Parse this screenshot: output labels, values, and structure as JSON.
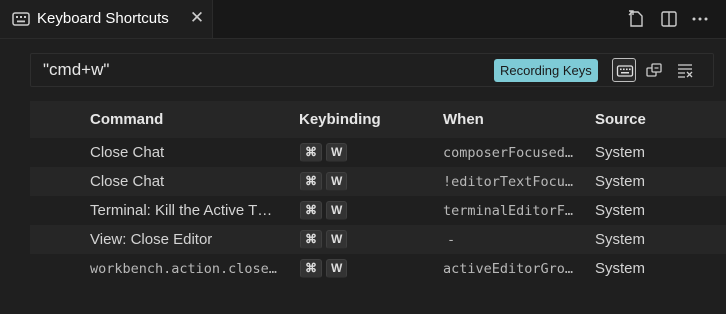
{
  "tab": {
    "title": "Keyboard Shortcuts",
    "close": "✕"
  },
  "search": {
    "value": "\"cmd+w\"",
    "badge": "Recording Keys"
  },
  "columns": {
    "command": "Command",
    "keybinding": "Keybinding",
    "when": "When",
    "source": "Source"
  },
  "rows": [
    {
      "command": "Close Chat",
      "keys": [
        "⌘",
        "W"
      ],
      "when": "composerFocused…",
      "source": "System",
      "mono": false
    },
    {
      "command": "Close Chat",
      "keys": [
        "⌘",
        "W"
      ],
      "when": "!editorTextFocu…",
      "source": "System",
      "mono": false
    },
    {
      "command": "Terminal: Kill the Active T…",
      "keys": [
        "⌘",
        "W"
      ],
      "when": "terminalEditorF…",
      "source": "System",
      "mono": false
    },
    {
      "command": "View: Close Editor",
      "keys": [
        "⌘",
        "W"
      ],
      "when": "-",
      "source": "System",
      "mono": false
    },
    {
      "command": "workbench.action.close…",
      "keys": [
        "⌘",
        "W"
      ],
      "when": "activeEditorGro…",
      "source": "System",
      "mono": true
    }
  ]
}
